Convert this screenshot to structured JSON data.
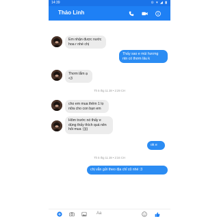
{
  "status_bar": {
    "time": "14:39",
    "icons": "⊙ ▾ ◢ ▮"
  },
  "header": {
    "contact_name": "Thảo Linh",
    "actions": [
      "phone-icon",
      "video-camera-icon",
      "info-icon"
    ]
  },
  "messages": [
    {
      "id": "m1",
      "direction": "incoming",
      "text": "Em nhận được nước hoa r nhé chị"
    },
    {
      "id": "m2",
      "direction": "outgoing",
      "text": "Thấy sao e mùi hương ntn có thơm lâu k"
    },
    {
      "id": "m3",
      "direction": "incoming",
      "text": "Thơm lắm ạ <3"
    },
    {
      "id": "m4",
      "direction": "incoming",
      "text": "cho em mua thêm 1 lọ nữa cho con bạn em"
    },
    {
      "id": "m5",
      "direction": "incoming",
      "text": "Hôm trước nó thấy e dùng thấy thích quá nên hỏi mua :))))"
    },
    {
      "id": "m6",
      "direction": "outgoing",
      "text": "ok e"
    },
    {
      "id": "m7",
      "direction": "outgoing",
      "text": "chị vẫn gửi theo địa chỉ cũ nhé :3"
    }
  ],
  "timestamps": [
    "Th 5 thg 11 28 • 2:29 CH",
    "Th 5 thg 11 28 • 2:34 CH"
  ],
  "composer": {
    "placeholder": "Aa",
    "icons": [
      "plus-icon",
      "camera-icon",
      "image-icon",
      "emoji-icon",
      "thumbs-up-icon"
    ]
  },
  "colors": {
    "header": "#1e80f5",
    "outgoing_bubble": "#2b8cf3",
    "incoming_bubble": "#ececec"
  }
}
